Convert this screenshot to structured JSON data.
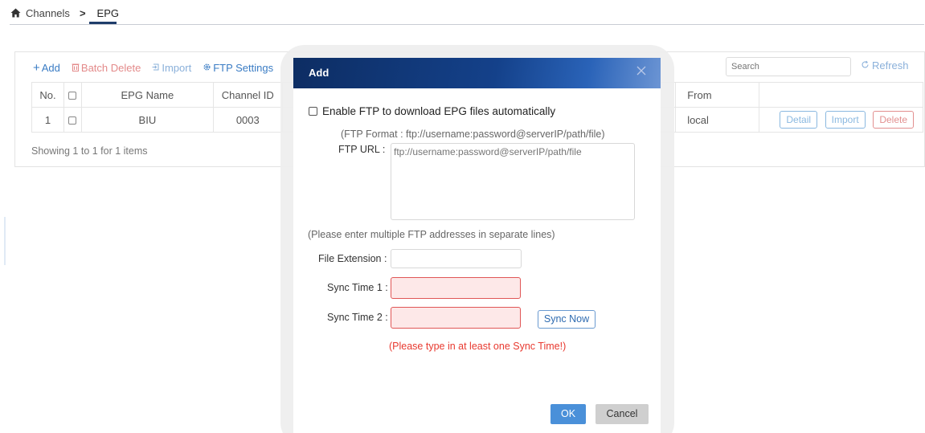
{
  "breadcrumb": {
    "root": "Channels",
    "separator": ">",
    "current": "EPG"
  },
  "toolbar": {
    "add_label": "Add",
    "batch_delete_label": "Batch Delete",
    "import_label": "Import",
    "ftp_settings_label": "FTP Settings",
    "search_placeholder": "Search",
    "refresh_label": "Refresh"
  },
  "table": {
    "columns": {
      "no": "No.",
      "epg_name": "EPG Name",
      "channel_id": "Channel ID",
      "from": "From"
    },
    "rows": [
      {
        "no": "1",
        "epg_name": "BIU",
        "channel_id": "0003",
        "from": "local",
        "actions": {
          "detail": "Detail",
          "import": "Import",
          "delete": "Delete"
        }
      }
    ],
    "showing": "Showing 1 to 1 for 1 items"
  },
  "modal": {
    "title": "Add",
    "enable_ftp_label": "Enable FTP to download EPG files automatically",
    "ftp_format": "(FTP Format :  ftp://username:password@serverIP/path/file)",
    "ftp_url_label": "FTP URL :",
    "ftp_url_placeholder": "ftp://username:password@serverIP/path/file",
    "multi_note": "(Please enter multiple FTP addresses in separate lines)",
    "file_extension_label": "File Extension :",
    "sync_time_1_label": "Sync Time 1 :",
    "sync_time_2_label": "Sync Time 2 :",
    "sync_now_label": "Sync Now",
    "warning": "(Please type in at least one Sync Time!)",
    "ok_label": "OK",
    "cancel_label": "Cancel"
  },
  "colors": {
    "accent": "#3a7cc4",
    "danger": "#e8392f",
    "header_dark": "#0d2d63",
    "invalid_fill": "#fde8e8"
  }
}
